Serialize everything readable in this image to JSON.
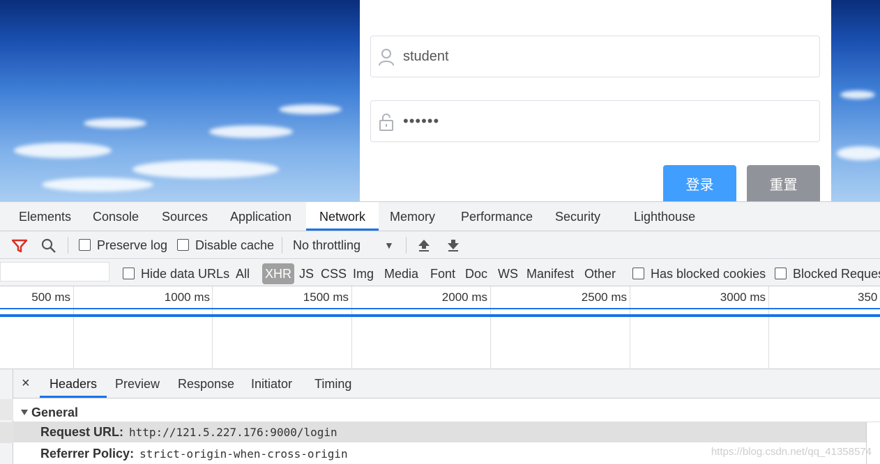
{
  "login": {
    "username_value": "student",
    "password_value": "••••••",
    "login_button": "登录",
    "reset_button": "重置"
  },
  "devtools": {
    "tabs": [
      "Elements",
      "Console",
      "Sources",
      "Application",
      "Network",
      "Memory",
      "Performance",
      "Security",
      "Lighthouse"
    ],
    "active_tab": "Network",
    "toolbar": {
      "preserve_log": "Preserve log",
      "disable_cache": "Disable cache",
      "throttling": "No throttling"
    },
    "filter": {
      "hide_data_urls": "Hide data URLs",
      "types": [
        "All",
        "XHR",
        "JS",
        "CSS",
        "Img",
        "Media",
        "Font",
        "Doc",
        "WS",
        "Manifest",
        "Other"
      ],
      "active_type": "XHR",
      "has_blocked_cookies": "Has blocked cookies",
      "blocked_requests": "Blocked Reques"
    },
    "timeline": {
      "ticks": [
        "500 ms",
        "1000 ms",
        "1500 ms",
        "2000 ms",
        "2500 ms",
        "3000 ms",
        "350"
      ]
    },
    "detail": {
      "close": "×",
      "tabs": [
        "Headers",
        "Preview",
        "Response",
        "Initiator",
        "Timing"
      ],
      "active_tab": "Headers",
      "section": "General",
      "rows": [
        {
          "key": "Request URL:",
          "value": "http://121.5.227.176:9000/login"
        },
        {
          "key": "Referrer Policy:",
          "value": "strict-origin-when-cross-origin"
        }
      ],
      "watermark": "https://blog.csdn.net/qq_41358574"
    }
  },
  "colors": {
    "accent": "#1a73e8",
    "login_button": "#409eff",
    "reset_button": "#909399",
    "filter_icon": "#d93025"
  }
}
